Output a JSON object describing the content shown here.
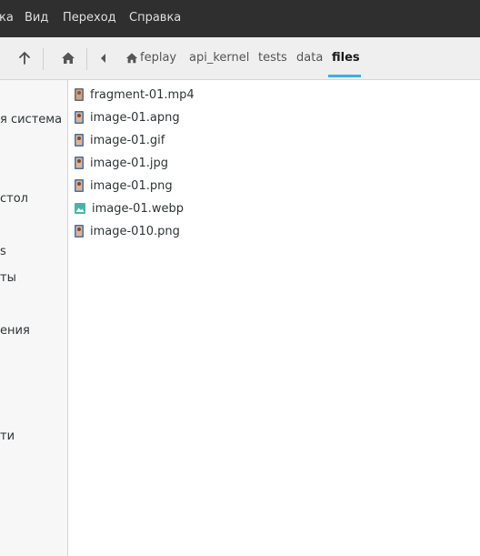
{
  "menubar": {
    "items": [
      "ка",
      "Вид",
      "Переход",
      "Справка"
    ]
  },
  "breadcrumb": {
    "items": [
      "feplay",
      "api_kernel",
      "tests",
      "data"
    ],
    "current": "files"
  },
  "sidebar": {
    "items": [
      "я система",
      "стол",
      "s",
      "ты",
      "ения",
      "ти"
    ]
  },
  "files": [
    {
      "name": "fragment-01.mp4",
      "icon": "video-file-icon"
    },
    {
      "name": "image-01.apng",
      "icon": "image-file-icon"
    },
    {
      "name": "image-01.gif",
      "icon": "image-file-icon"
    },
    {
      "name": "image-01.jpg",
      "icon": "image-file-icon"
    },
    {
      "name": "image-01.png",
      "icon": "image-file-icon"
    },
    {
      "name": "image-01.webp",
      "icon": "webp-file-icon"
    },
    {
      "name": "image-010.png",
      "icon": "image-file-icon"
    }
  ],
  "colors": {
    "accent": "#3daee9",
    "menubar_bg": "#2f2f2f",
    "toolbar_bg": "#efefef",
    "sidebar_bg": "#f7f7f7"
  }
}
